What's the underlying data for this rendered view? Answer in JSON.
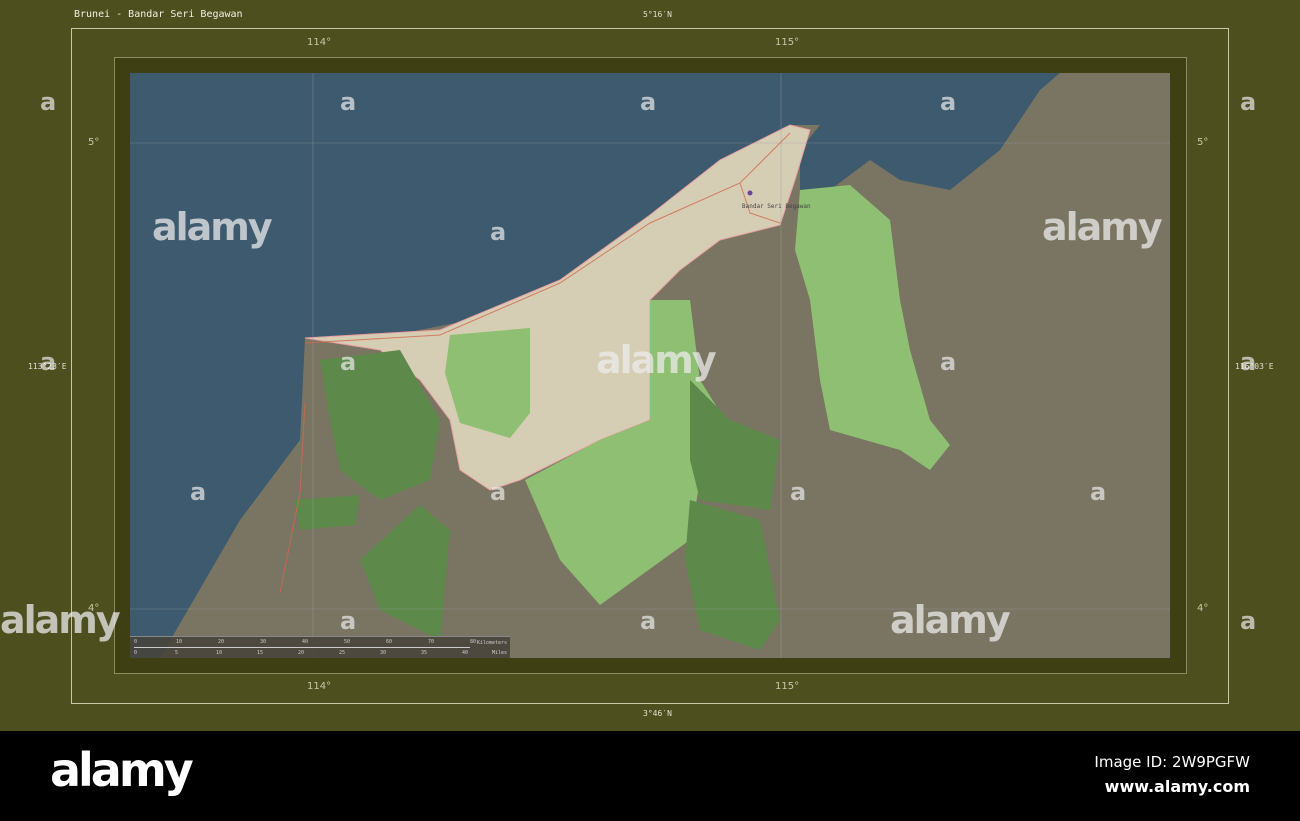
{
  "title": "Brunei - Bandar Seri Begawan",
  "coords": {
    "top": "5°16′N",
    "bottom": "3°46′N",
    "left": "113°23′E",
    "right": "116°03′E",
    "lon_ticks": [
      "114°",
      "115°"
    ],
    "lat_ticks": [
      "5°",
      "4°"
    ]
  },
  "places": {
    "capital": "Bandar Seri Begawan"
  },
  "scale": {
    "km_label": "Kilometers",
    "mi_label": "Miles",
    "km_ticks": [
      "0",
      "10",
      "20",
      "30",
      "40",
      "50",
      "60",
      "70",
      "80"
    ],
    "mi_ticks": [
      "0",
      "5",
      "10",
      "15",
      "20",
      "25",
      "30",
      "35",
      "40"
    ]
  },
  "watermark": "alamy",
  "watermark_letter": "a",
  "footer": {
    "logo": "alamy",
    "image_id": "Image ID: 2W9PGFW",
    "site": "www.alamy.com"
  },
  "colors": {
    "sea": "#3d5a6e",
    "land": "#7a7462",
    "highlight": "#d6cdb5",
    "green": "#8fbf72",
    "forest": "#5d8a4a",
    "frame": "#4d4f1f"
  }
}
